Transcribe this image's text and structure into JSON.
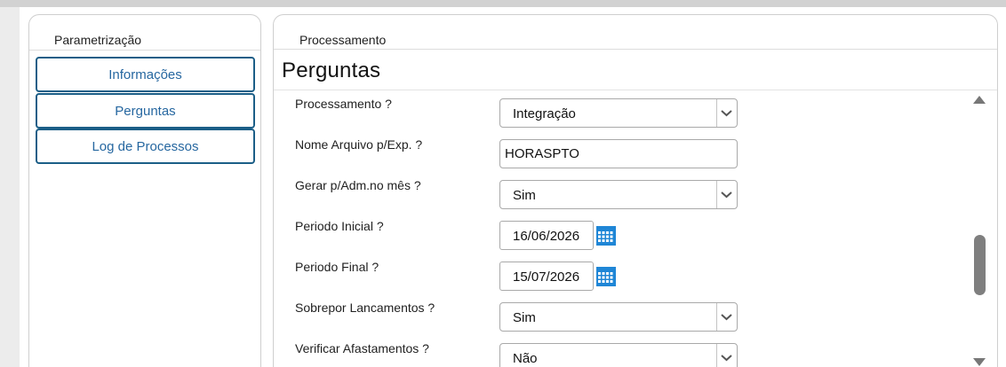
{
  "sidebar": {
    "title": "Parametrização",
    "items": [
      {
        "label": "Informações"
      },
      {
        "label": "Perguntas"
      },
      {
        "label": "Log de Processos"
      }
    ]
  },
  "main": {
    "tab_title": "Processamento",
    "page_title": "Perguntas",
    "questions": [
      {
        "label": "Processamento ?",
        "type": "select",
        "value": "Integração"
      },
      {
        "label": "Nome Arquivo p/Exp. ?",
        "type": "text",
        "value": "HORASPTO"
      },
      {
        "label": "Gerar p/Adm.no mês ?",
        "type": "select",
        "value": "Sim"
      },
      {
        "label": "Periodo Inicial ?",
        "type": "date",
        "value": "16/06/2026"
      },
      {
        "label": "Periodo Final ?",
        "type": "date",
        "value": "15/07/2026"
      },
      {
        "label": "Sobrepor Lancamentos ?",
        "type": "select",
        "value": "Sim"
      },
      {
        "label": "Verificar Afastamentos ?",
        "type": "select",
        "value": "Não"
      }
    ]
  },
  "icons": {
    "chevron": "chevron-down-icon",
    "calendar": "calendar-icon",
    "scroll_up": "triangle-up",
    "scroll_down": "triangle-down"
  },
  "colors": {
    "accent": "#1b5e87",
    "link_text": "#2667a0",
    "calendar_blue": "#1f86d6"
  }
}
